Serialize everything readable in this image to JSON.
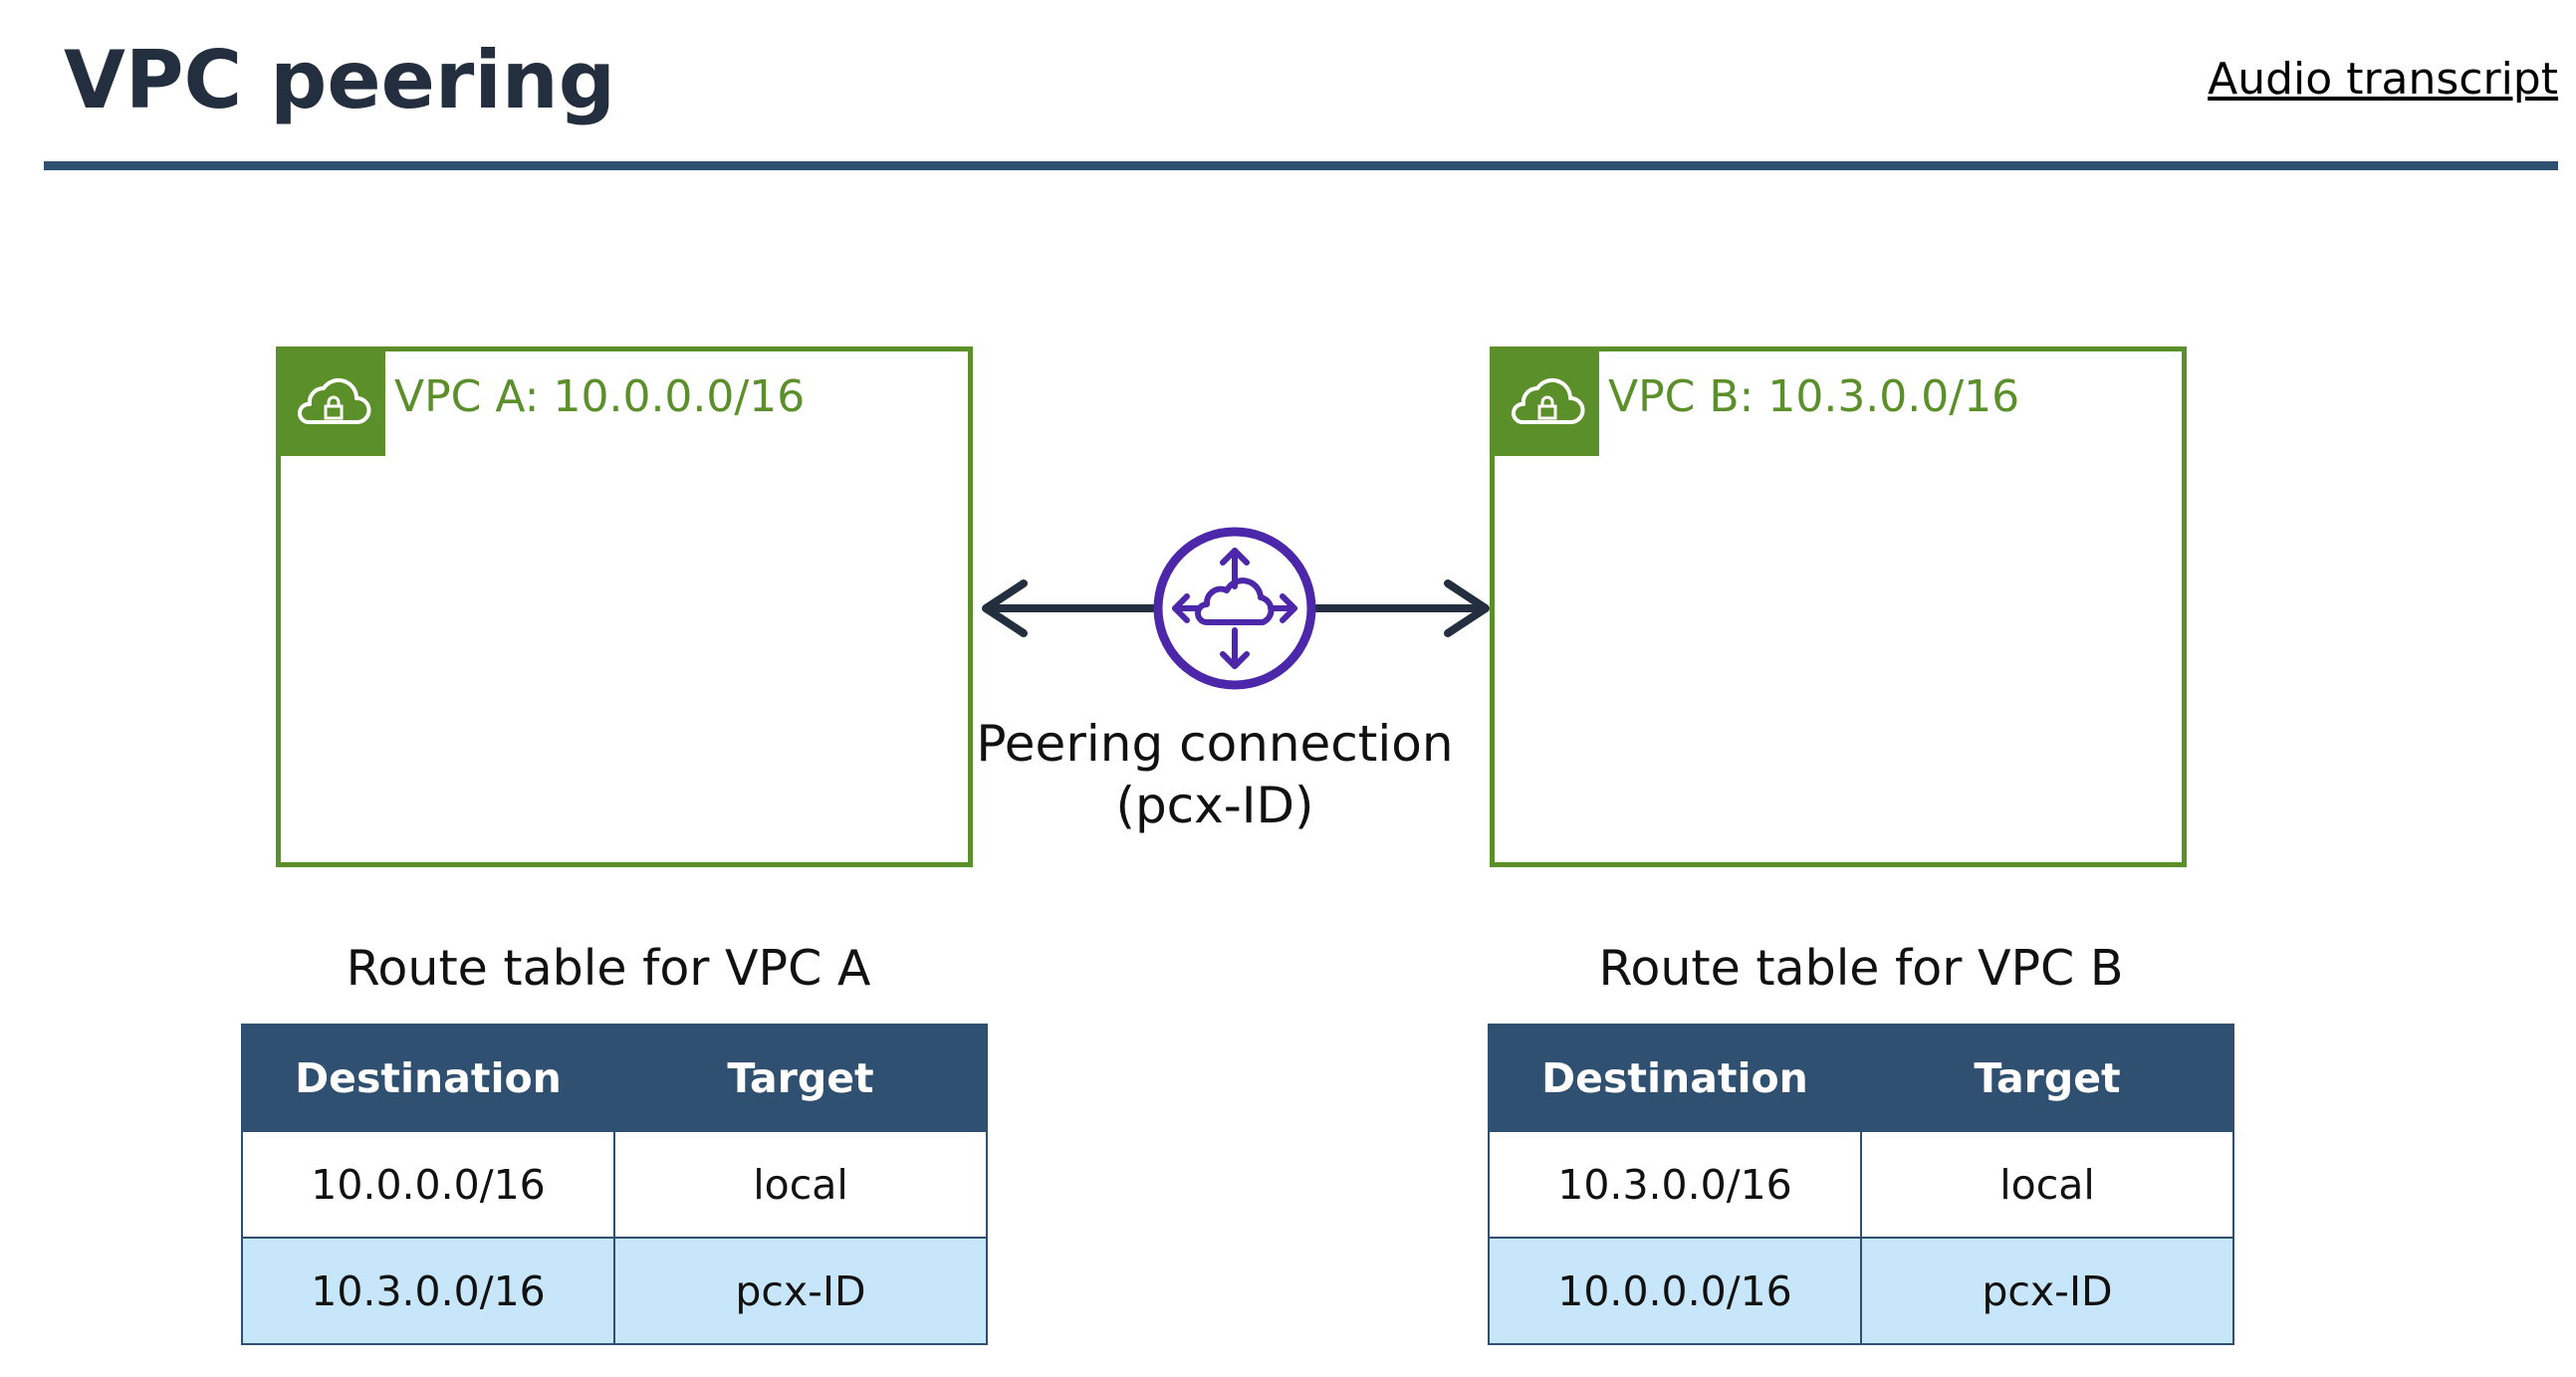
{
  "header": {
    "title": "VPC peering",
    "transcript_link": "Audio transcript"
  },
  "diagram": {
    "vpc_a": {
      "label": "VPC A: 10.0.0.0/16"
    },
    "vpc_b": {
      "label": "VPC B: 10.3.0.0/16"
    },
    "peering": {
      "line1": "Peering connection",
      "line2": "(pcx-ID)"
    }
  },
  "route_tables": {
    "a": {
      "title": "Route table for VPC A",
      "headers": [
        "Destination",
        "Target"
      ],
      "rows": [
        [
          "10.0.0.0/16",
          "local"
        ],
        [
          "10.3.0.0/16",
          "pcx-ID"
        ]
      ]
    },
    "b": {
      "title": "Route table for VPC B",
      "headers": [
        "Destination",
        "Target"
      ],
      "rows": [
        [
          "10.3.0.0/16",
          "local"
        ],
        [
          "10.0.0.0/16",
          "pcx-ID"
        ]
      ]
    }
  },
  "colors": {
    "vpc_green": "#5a8f29",
    "header_navy": "#2f5070",
    "peering_purple": "#4d27aa",
    "arrow_dark": "#232f3e",
    "alt_row_blue": "#c8e6fa"
  },
  "icons": {
    "vpc_badge": "cloud-lock-icon",
    "peering": "cloud-arrows-icon"
  }
}
